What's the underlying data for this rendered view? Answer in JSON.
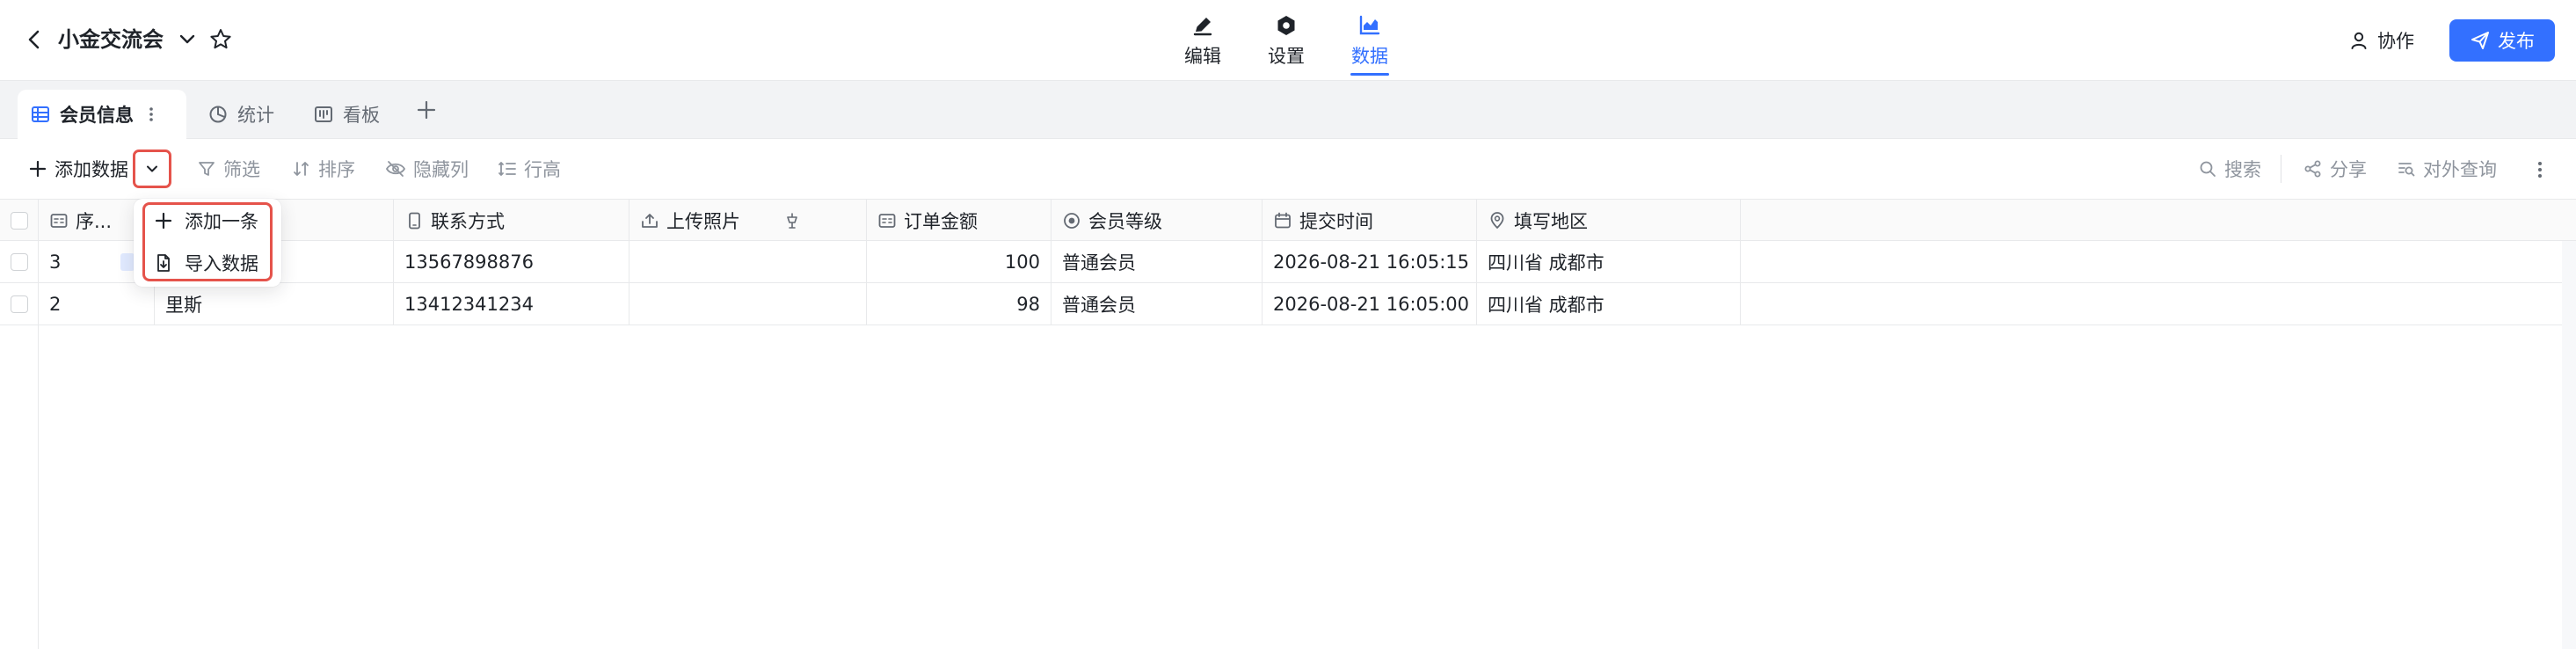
{
  "header": {
    "title": "小金交流会",
    "modes": [
      {
        "label": "编辑",
        "icon": "pencil-icon"
      },
      {
        "label": "设置",
        "icon": "gear-icon"
      },
      {
        "label": "数据",
        "icon": "chart-icon",
        "active": true
      }
    ],
    "collab_label": "协作",
    "publish_label": "发布"
  },
  "views": {
    "tabs": [
      {
        "label": "会员信息",
        "icon": "table-icon",
        "active": true
      },
      {
        "label": "统计",
        "icon": "pie-chart-icon"
      },
      {
        "label": "看板",
        "icon": "kanban-icon"
      }
    ]
  },
  "toolbar": {
    "add_label": "添加数据",
    "filter_label": "筛选",
    "sort_label": "排序",
    "hide_label": "隐藏列",
    "row_height_label": "行高",
    "search_label": "搜索",
    "share_label": "分享",
    "public_query_label": "对外查询"
  },
  "add_menu": {
    "items": [
      {
        "label": "添加一条",
        "icon": "plus-icon"
      },
      {
        "label": "导入数据",
        "icon": "import-file-icon"
      }
    ]
  },
  "table": {
    "columns": [
      {
        "label": "序...",
        "icon": "id-card-icon"
      },
      {
        "label": "",
        "icon": ""
      },
      {
        "label": "联系方式",
        "icon": "phone-icon"
      },
      {
        "label": "上传照片",
        "icon": "upload-icon"
      },
      {
        "label": "订单金额",
        "icon": "id-card-icon"
      },
      {
        "label": "会员等级",
        "icon": "radio-icon"
      },
      {
        "label": "提交时间",
        "icon": "calendar-icon"
      },
      {
        "label": "填写地区",
        "icon": "location-icon"
      }
    ],
    "rows": [
      {
        "seq": "3",
        "name": "",
        "phone": "13567898876",
        "photo": "",
        "amount": "100",
        "level": "普通会员",
        "time": "2026-08-21 16:05:15",
        "region": "四川省 成都市"
      },
      {
        "seq": "2",
        "name": "里斯",
        "phone": "13412341234",
        "photo": "",
        "amount": "98",
        "level": "普通会员",
        "time": "2026-08-21 16:05:00",
        "region": "四川省 成都市"
      }
    ]
  },
  "colors": {
    "accent": "#3370ff",
    "highlight": "#e5534b"
  }
}
